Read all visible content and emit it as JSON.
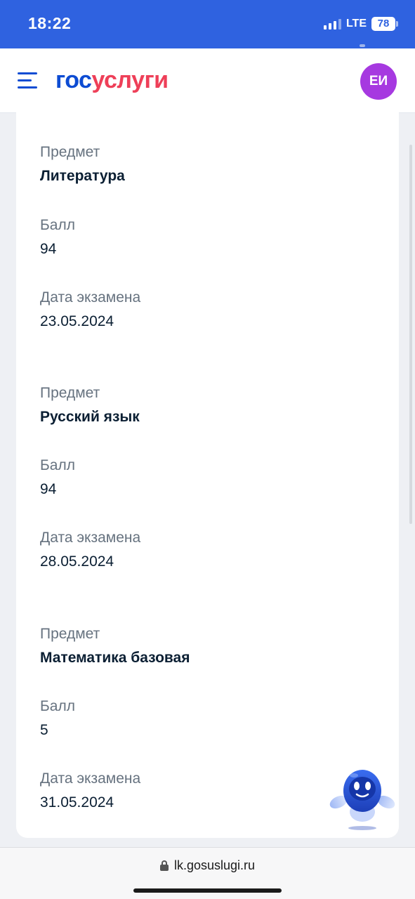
{
  "status_bar": {
    "time": "18:22",
    "network": "LTE",
    "battery": "78"
  },
  "header": {
    "logo_part1": "гос",
    "logo_part2": "услуги",
    "avatar_initials": "ЕИ"
  },
  "exams": [
    {
      "subject_label": "Предмет",
      "subject": "Литература",
      "score_label": "Балл",
      "score": "94",
      "date_label": "Дата экзамена",
      "date": "23.05.2024"
    },
    {
      "subject_label": "Предмет",
      "subject": "Русский язык",
      "score_label": "Балл",
      "score": "94",
      "date_label": "Дата экзамена",
      "date": "28.05.2024"
    },
    {
      "subject_label": "Предмет",
      "subject": "Математика базовая",
      "score_label": "Балл",
      "score": "5",
      "date_label": "Дата экзамена",
      "date": "31.05.2024"
    }
  ],
  "browser": {
    "url": "lk.gosuslugi.ru"
  },
  "colors": {
    "status_bar": "#2f62e0",
    "brand_blue": "#0d4cd3",
    "brand_red": "#ee3f58",
    "avatar": "#a639e0"
  }
}
